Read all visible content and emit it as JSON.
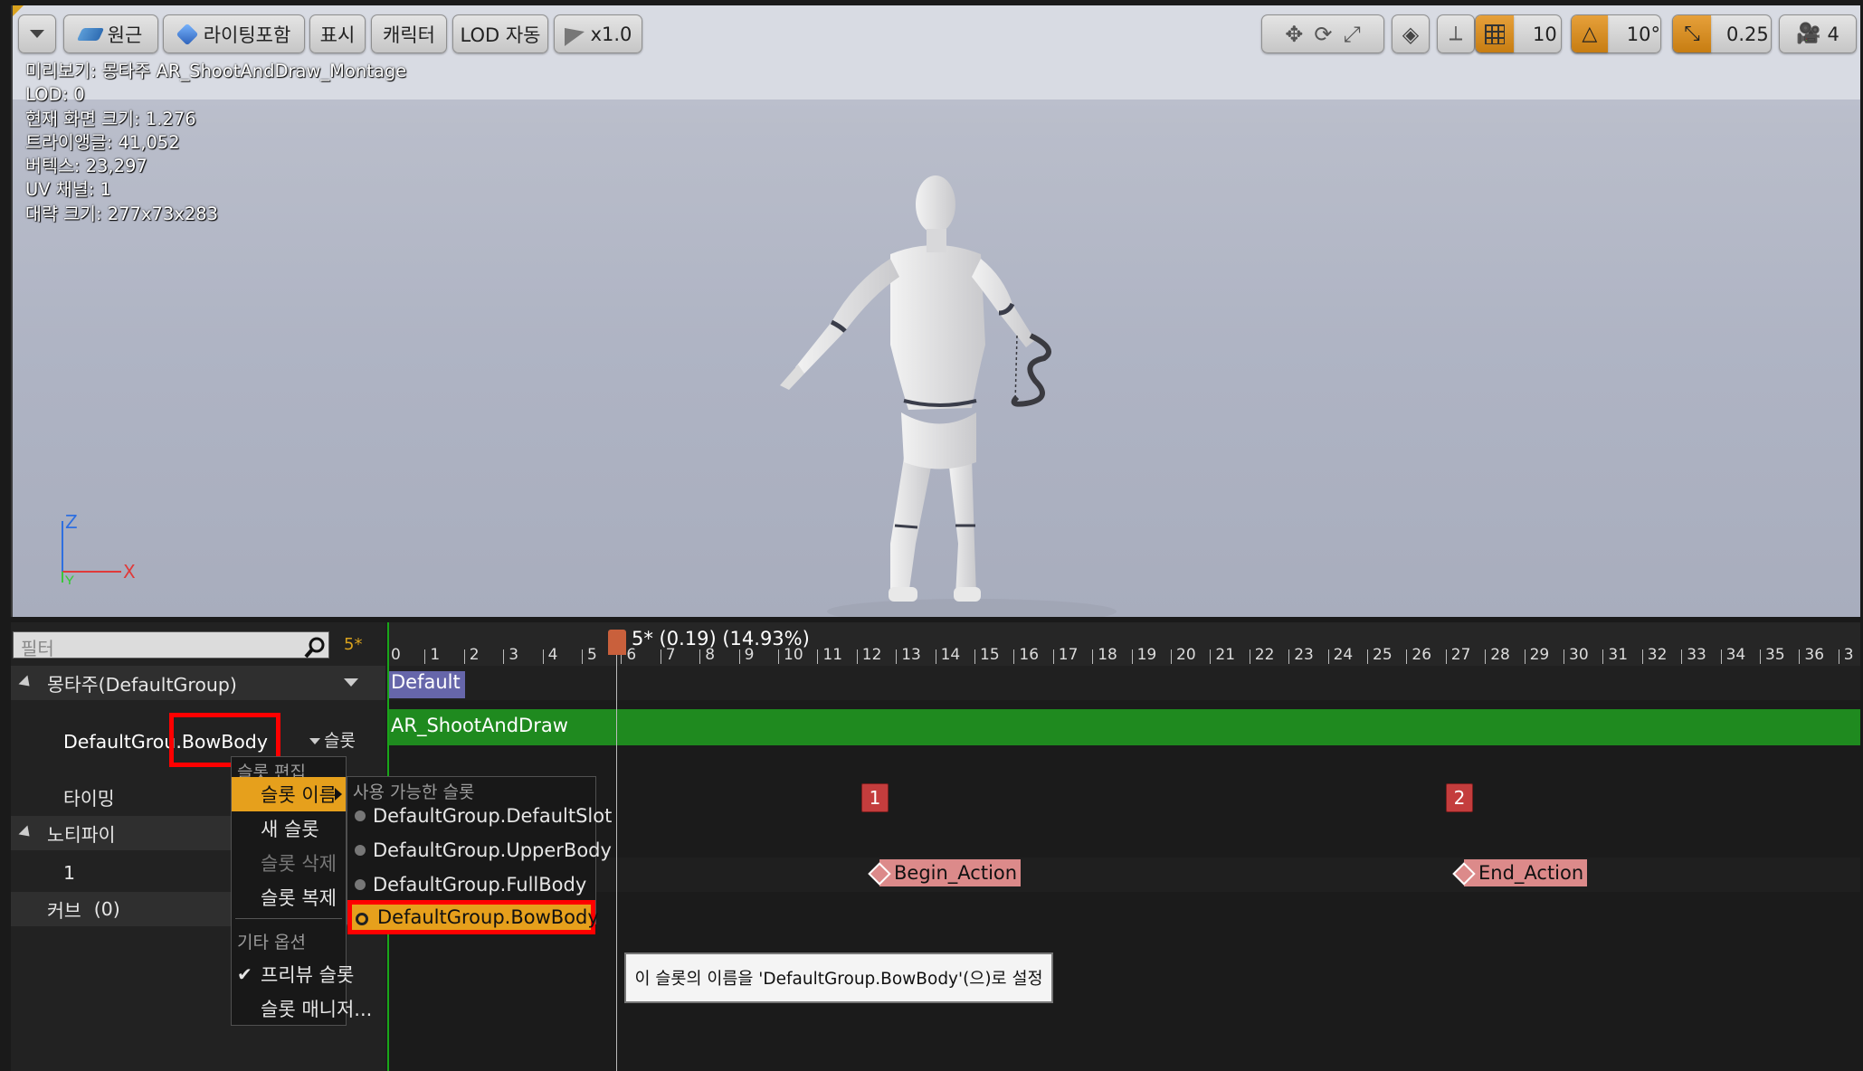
{
  "toolbar": {
    "perspective": "원근",
    "lighting": "라이팅포함",
    "show": "표시",
    "character": "캐릭터",
    "lod": "LOD 자동",
    "speed": "x1.0",
    "grid_snap": "10",
    "rotation_snap": "10°",
    "scale_snap": "0.25",
    "camera_speed": "4"
  },
  "stats": [
    "미리보기: 몽타주 AR_ShootAndDraw_Montage",
    "LOD: 0",
    "현재 화면 크기: 1.276",
    "트라이앵글: 41,052",
    "버텍스: 23,297",
    "UV 채널: 1",
    "대략 크기: 277x73x283"
  ],
  "axes": {
    "z": "Z",
    "x": "X",
    "y": "Y"
  },
  "left_panel": {
    "filter_placeholder": "필터",
    "count": "5*",
    "montage_header": "몽타주(DefaultGroup)",
    "slot_name_left": "DefaultGrou",
    "slot_name_right": ".BowBody",
    "slot_dropdown": "슬롯",
    "timing": "타이밍",
    "notify_header": "노티파이",
    "notify_track": "1",
    "curve_label": "커브",
    "curve_count": "(0)"
  },
  "timeline": {
    "current": "5* (0.19) (14.93%)",
    "ticks": [
      "0",
      "1",
      "2",
      "3",
      "4",
      "5",
      "6",
      "7",
      "8",
      "9",
      "10",
      "11",
      "12",
      "13",
      "14",
      "15",
      "16",
      "17",
      "18",
      "19",
      "20",
      "21",
      "22",
      "23",
      "24",
      "25",
      "26",
      "27",
      "28",
      "29",
      "30",
      "31",
      "32",
      "33",
      "34",
      "35",
      "36",
      "3"
    ],
    "section": "Default",
    "anim_segment": "AR_ShootAndDraw",
    "notifies": [
      {
        "index": "1",
        "label": "Begin_Action"
      },
      {
        "index": "2",
        "label": "End_Action"
      }
    ]
  },
  "context_menu": {
    "section_edit": "슬롯 편집",
    "slot_name": "슬롯 이름",
    "new_slot": "새 슬롯",
    "delete_slot": "슬롯 삭제",
    "duplicate_slot": "슬롯 복제",
    "section_other": "기타 옵션",
    "preview_slot": "프리뷰 슬롯",
    "slot_manager": "슬롯 매니저..."
  },
  "submenu": {
    "header": "사용 가능한 슬롯",
    "items": [
      "DefaultGroup.DefaultSlot",
      "DefaultGroup.UpperBody",
      "DefaultGroup.FullBody",
      "DefaultGroup.BowBody"
    ]
  },
  "tooltip": "이 슬롯의 이름을 'DefaultGroup.BowBody'(으)로 설정",
  "colors": {
    "accent": "#e6a01c",
    "highlight": "#ff0000",
    "anim_track": "#1f8a1f",
    "notify": "#c43d3d"
  }
}
